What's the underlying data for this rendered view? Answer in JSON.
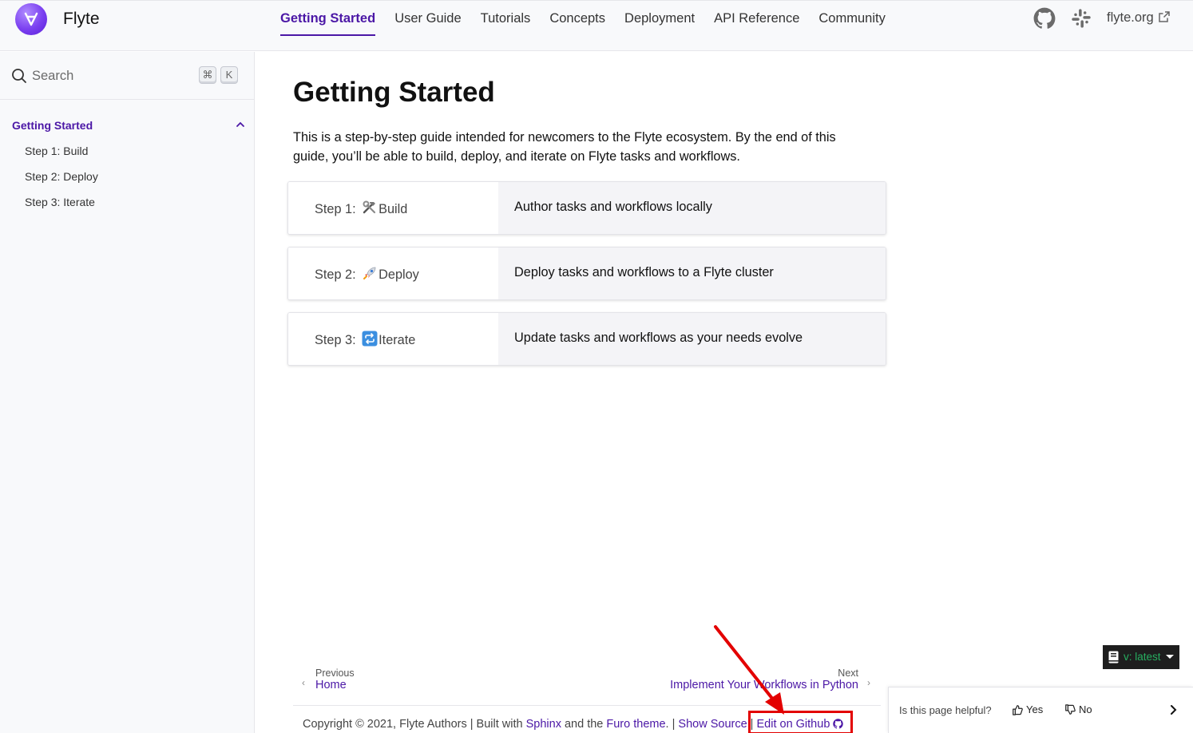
{
  "header": {
    "brand": "Flyte",
    "nav": [
      {
        "label": "Getting Started",
        "active": true
      },
      {
        "label": "User Guide",
        "active": false
      },
      {
        "label": "Tutorials",
        "active": false
      },
      {
        "label": "Concepts",
        "active": false
      },
      {
        "label": "Deployment",
        "active": false
      },
      {
        "label": "API Reference",
        "active": false
      },
      {
        "label": "Community",
        "active": false
      }
    ],
    "external_link": "flyte.org",
    "icons": [
      "github-icon",
      "slack-icon",
      "external-link-icon"
    ]
  },
  "sidebar": {
    "search_placeholder": "Search",
    "shortcut_keys": [
      "⌘",
      "K"
    ],
    "section_title": "Getting Started",
    "items": [
      "Step 1: Build",
      "Step 2: Deploy",
      "Step 3: Iterate"
    ]
  },
  "main": {
    "title": "Getting Started",
    "intro": "This is a step-by-step guide intended for newcomers to the Flyte ecosystem. By the end of this guide, you’ll be able to build, deploy, and iterate on Flyte tasks and workflows.",
    "steps": [
      {
        "prefix": "Step  1:",
        "name": "Build",
        "emoji": "hammer-and-wrench-icon",
        "description": "Author tasks and workflows locally"
      },
      {
        "prefix": "Step  2:",
        "name": "Deploy",
        "emoji": "rocket-icon",
        "description": "Deploy tasks and workflows to a Flyte cluster"
      },
      {
        "prefix": "Step  3:",
        "name": "Iterate",
        "emoji": "repeat-icon",
        "description": "Update tasks and workflows as your needs evolve"
      }
    ]
  },
  "pager": {
    "prev_label": "Previous",
    "prev_title": "Home",
    "next_label": "Next",
    "next_title": "Implement Your Workflows in Python"
  },
  "footer": {
    "copyright": "Copyright © 2021, Flyte Authors | Built with ",
    "sphinx": "Sphinx",
    "and_the": " and the ",
    "furo": "Furo theme",
    "sep": ". | ",
    "show_source": "Show Source",
    "sep2": " | ",
    "edit_github": "Edit on Github"
  },
  "version_badge": {
    "label": "v: latest"
  },
  "helpful": {
    "question": "Is this page helpful?",
    "yes": "Yes",
    "no": "No"
  },
  "colors": {
    "accent": "#4b17a6",
    "highlight": "#e30000",
    "version_text": "#27ae60"
  }
}
